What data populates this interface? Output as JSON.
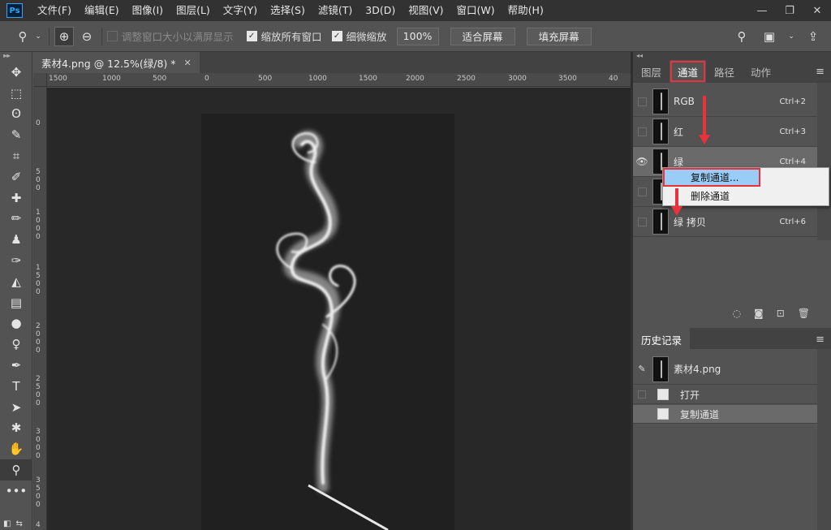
{
  "app": {
    "logo": "Ps",
    "menu": [
      "文件(F)",
      "编辑(E)",
      "图像(I)",
      "图层(L)",
      "文字(Y)",
      "选择(S)",
      "滤镜(T)",
      "3D(D)",
      "视图(V)",
      "窗口(W)",
      "帮助(H)"
    ],
    "window_controls": [
      "—",
      "❐",
      "✕"
    ]
  },
  "options_bar": {
    "tool_icon": "zoom-icon",
    "zoom_in_icon": "zoom-in-icon",
    "zoom_out_icon": "zoom-out-icon",
    "resize_windows_label": "调整窗口大小以满屏显示",
    "resize_windows_checked": false,
    "zoom_all_windows_label": "缩放所有窗口",
    "zoom_all_windows_checked": true,
    "scrubby_zoom_label": "细微缩放",
    "scrubby_zoom_checked": true,
    "zoom_percent": "100%",
    "fit_screen_label": "适合屏幕",
    "fill_screen_label": "填充屏幕"
  },
  "toolbar": {
    "tools": [
      {
        "icon": "move-icon",
        "glyph": "✥"
      },
      {
        "icon": "marquee-icon",
        "glyph": "⬚"
      },
      {
        "icon": "lasso-icon",
        "glyph": "ʘ"
      },
      {
        "icon": "quick-select-icon",
        "glyph": "✎"
      },
      {
        "icon": "crop-icon",
        "glyph": "⌗"
      },
      {
        "icon": "eyedropper-icon",
        "glyph": "✐"
      },
      {
        "icon": "healing-icon",
        "glyph": "✚"
      },
      {
        "icon": "brush-icon",
        "glyph": "✏"
      },
      {
        "icon": "stamp-icon",
        "glyph": "♟"
      },
      {
        "icon": "history-brush-icon",
        "glyph": "✑"
      },
      {
        "icon": "eraser-icon",
        "glyph": "◭"
      },
      {
        "icon": "gradient-icon",
        "glyph": "▤"
      },
      {
        "icon": "blur-icon",
        "glyph": "●"
      },
      {
        "icon": "dodge-icon",
        "glyph": "♀"
      },
      {
        "icon": "pen-icon",
        "glyph": "✒"
      },
      {
        "icon": "type-icon",
        "glyph": "T"
      },
      {
        "icon": "path-select-icon",
        "glyph": "➤"
      },
      {
        "icon": "shape-icon",
        "glyph": "✱"
      },
      {
        "icon": "hand-icon",
        "glyph": "✋"
      },
      {
        "icon": "zoom-tool-icon",
        "glyph": "⚲"
      },
      {
        "icon": "more-tools-icon",
        "glyph": "•••"
      }
    ],
    "active_index": 19
  },
  "document": {
    "tab_title": "素材4.png @ 12.5%(绿/8) *",
    "ruler_h": [
      "1500",
      "1000",
      "500",
      "0",
      "500",
      "1000",
      "1500",
      "2000",
      "2500",
      "3000",
      "3500",
      "40"
    ],
    "ruler_v": [
      "0",
      "500",
      "1000",
      "1500",
      "2000",
      "2500",
      "3000",
      "3500",
      "4"
    ]
  },
  "channels_panel": {
    "tabs": [
      "图层",
      "通道",
      "路径",
      "动作"
    ],
    "active_tab": "通道",
    "menu_icon": "panel-menu-icon",
    "channels": [
      {
        "name": "RGB",
        "shortcut": "Ctrl+2",
        "visible": false,
        "selected": false
      },
      {
        "name": "红",
        "shortcut": "Ctrl+3",
        "visible": false,
        "selected": false
      },
      {
        "name": "绿",
        "shortcut": "Ctrl+4",
        "visible": true,
        "selected": true
      },
      {
        "name": "",
        "shortcut": "",
        "visible": false,
        "selected": false
      },
      {
        "name": "绿 拷贝",
        "shortcut": "Ctrl+6",
        "visible": false,
        "selected": false
      }
    ],
    "footer_icons": [
      "load-selection-icon",
      "save-selection-icon",
      "new-channel-icon",
      "trash-icon"
    ]
  },
  "context_menu": {
    "items": [
      "复制通道...",
      "删除通道"
    ],
    "highlighted": "复制通道..."
  },
  "history_panel": {
    "tab": "历史记录",
    "snapshot": "素材4.png",
    "states": [
      "打开",
      "复制通道"
    ],
    "selected_state": "复制通道"
  },
  "colors": {
    "accent_red": "#e8323c",
    "menu_highlight": "#99ccf7",
    "panel_bg": "#535353",
    "canvas_bg": "#282828"
  }
}
